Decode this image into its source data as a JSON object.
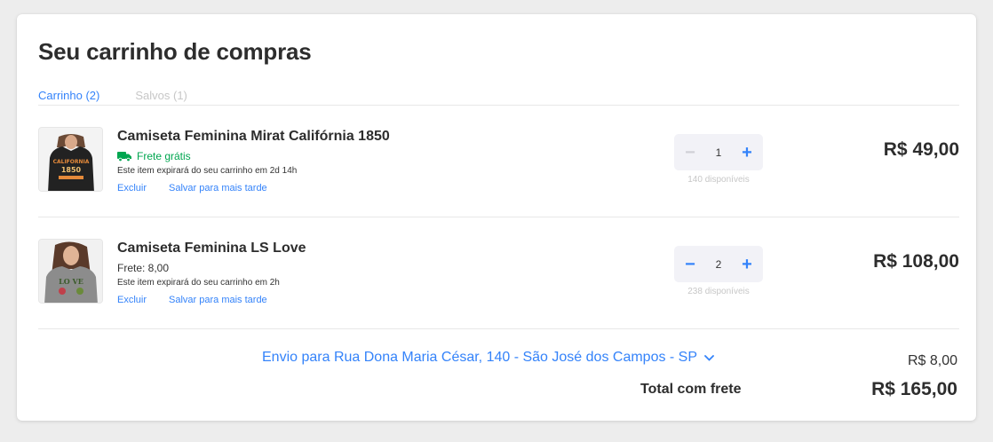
{
  "page": {
    "title": "Seu carrinho de compras"
  },
  "tabs": [
    {
      "label": "Carrinho (2)",
      "active": true
    },
    {
      "label": "Salvos (1)",
      "active": false
    }
  ],
  "items": [
    {
      "title": "Camiseta Feminina Mirat Califórnia 1850",
      "shipping": "Frete grátis",
      "shipping_icon": "truck-icon",
      "expiry": "Este item expirará do seu carrinho em 2d 14h",
      "delete_label": "Excluir",
      "save_label": "Salvar para mais tarde",
      "quantity": "1",
      "minus_symbol": "−",
      "plus_symbol": "+",
      "available": "140 disponíveis",
      "price": "R$ 49,00",
      "image": "black-tshirt-california-image"
    },
    {
      "title": "Camiseta Feminina LS Love",
      "shipping": "Frete: 8,00",
      "expiry": "Este item expirará do seu carrinho em 2h",
      "delete_label": "Excluir",
      "save_label": "Salvar para mais tarde",
      "quantity": "2",
      "minus_symbol": "−",
      "plus_symbol": "+",
      "available": "238 disponíveis",
      "price": "R$ 108,00",
      "image": "grey-tshirt-love-image"
    }
  ],
  "summary": {
    "shipping_to": "Envio para Rua Dona Maria César, 140 - São José dos Campos - SP",
    "shipping_cost": "R$ 8,00",
    "total_label": "Total com frete",
    "total_value": "R$ 165,00"
  },
  "colors": {
    "accent": "#3483fa",
    "free_shipping": "#00a650",
    "muted": "#c7c7c7"
  }
}
